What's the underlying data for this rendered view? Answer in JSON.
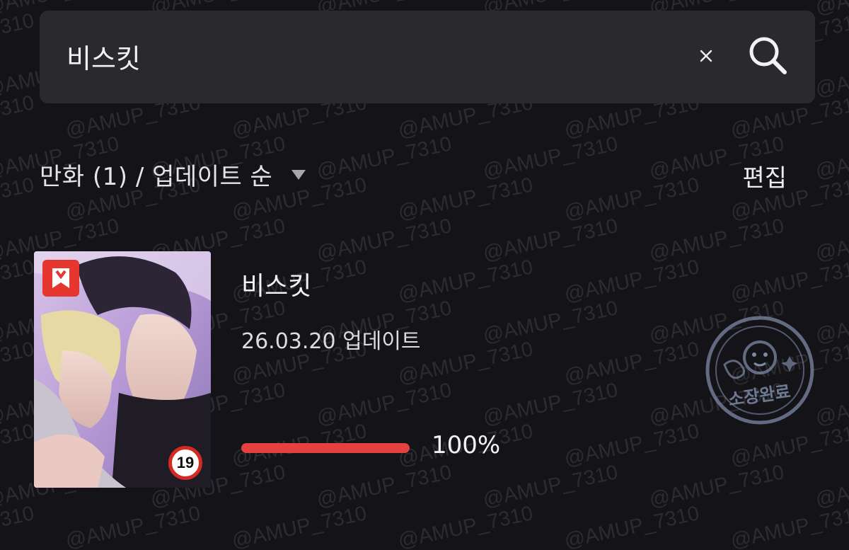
{
  "search": {
    "value": "비스킷",
    "clear_icon": "close-icon",
    "search_icon": "search-icon"
  },
  "filter": {
    "label": "만화 (1) / 업데이트 순",
    "dropdown_icon": "triangle-down-icon"
  },
  "edit_label": "편집",
  "items": [
    {
      "title": "비스킷",
      "updated": "26.03.20 업데이트",
      "progress": 1.0,
      "progress_label": "100%",
      "age_rating": "19",
      "badge_icon": "red-bookmark-badge-icon",
      "stamp_text": "소장완료"
    }
  ],
  "watermark_text": "@AMUP_7310",
  "colors": {
    "background": "#141317",
    "search_bg": "#2a292e",
    "accent_red": "#e5423f",
    "text": "#ececee"
  }
}
